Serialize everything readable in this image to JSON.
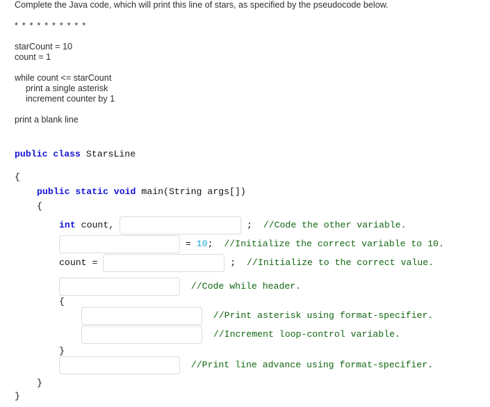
{
  "prompt": {
    "instruction": "Complete the Java code, which will print this line of stars, as specified by the pseudocode below.",
    "stars": "* * * * * * * * * *"
  },
  "pseudocode": {
    "lines": [
      "starCount = 10",
      "count = 1",
      "while count <= starCount",
      "print a single asterisk",
      "increment counter by 1",
      "print a blank line"
    ]
  },
  "code": {
    "class_decl": {
      "keywords": "public class",
      "name": "StarsLine"
    },
    "open_brace_class": "{",
    "main_decl": {
      "keywords": "public static void",
      "signature": "main(String args[])"
    },
    "open_brace_main": "{",
    "line_decl": {
      "type_keyword": "int",
      "first_var": "count,",
      "terminator": ";",
      "comment": "//Code the other variable."
    },
    "line_init_ten": {
      "assign": "= ",
      "value": "10",
      "terminator": ";",
      "comment": "//Initialize the correct variable to 10."
    },
    "line_count_assign": {
      "lhs": "count =",
      "terminator": ";",
      "comment": "//Initialize to the correct value."
    },
    "line_while": {
      "comment": "//Code while header."
    },
    "open_brace_loop": "{",
    "line_print_star": {
      "comment": "//Print asterisk using format-specifier."
    },
    "line_increment": {
      "comment": "//Increment loop-control variable."
    },
    "close_brace_loop": "}",
    "line_line_advance": {
      "comment": "//Print line advance using format-specifier."
    },
    "close_brace_main": "}",
    "close_brace_class": "}"
  },
  "blanks": {
    "decl_other_var": "",
    "init_target_var": "",
    "count_value": "",
    "while_header": "",
    "print_star": "",
    "increment": "",
    "line_advance": ""
  },
  "colors": {
    "keyword": "#1515d6",
    "comment": "#116611",
    "number": "#18a9d6",
    "text": "#2e2e2e",
    "field_border": "#dcdcdc"
  }
}
